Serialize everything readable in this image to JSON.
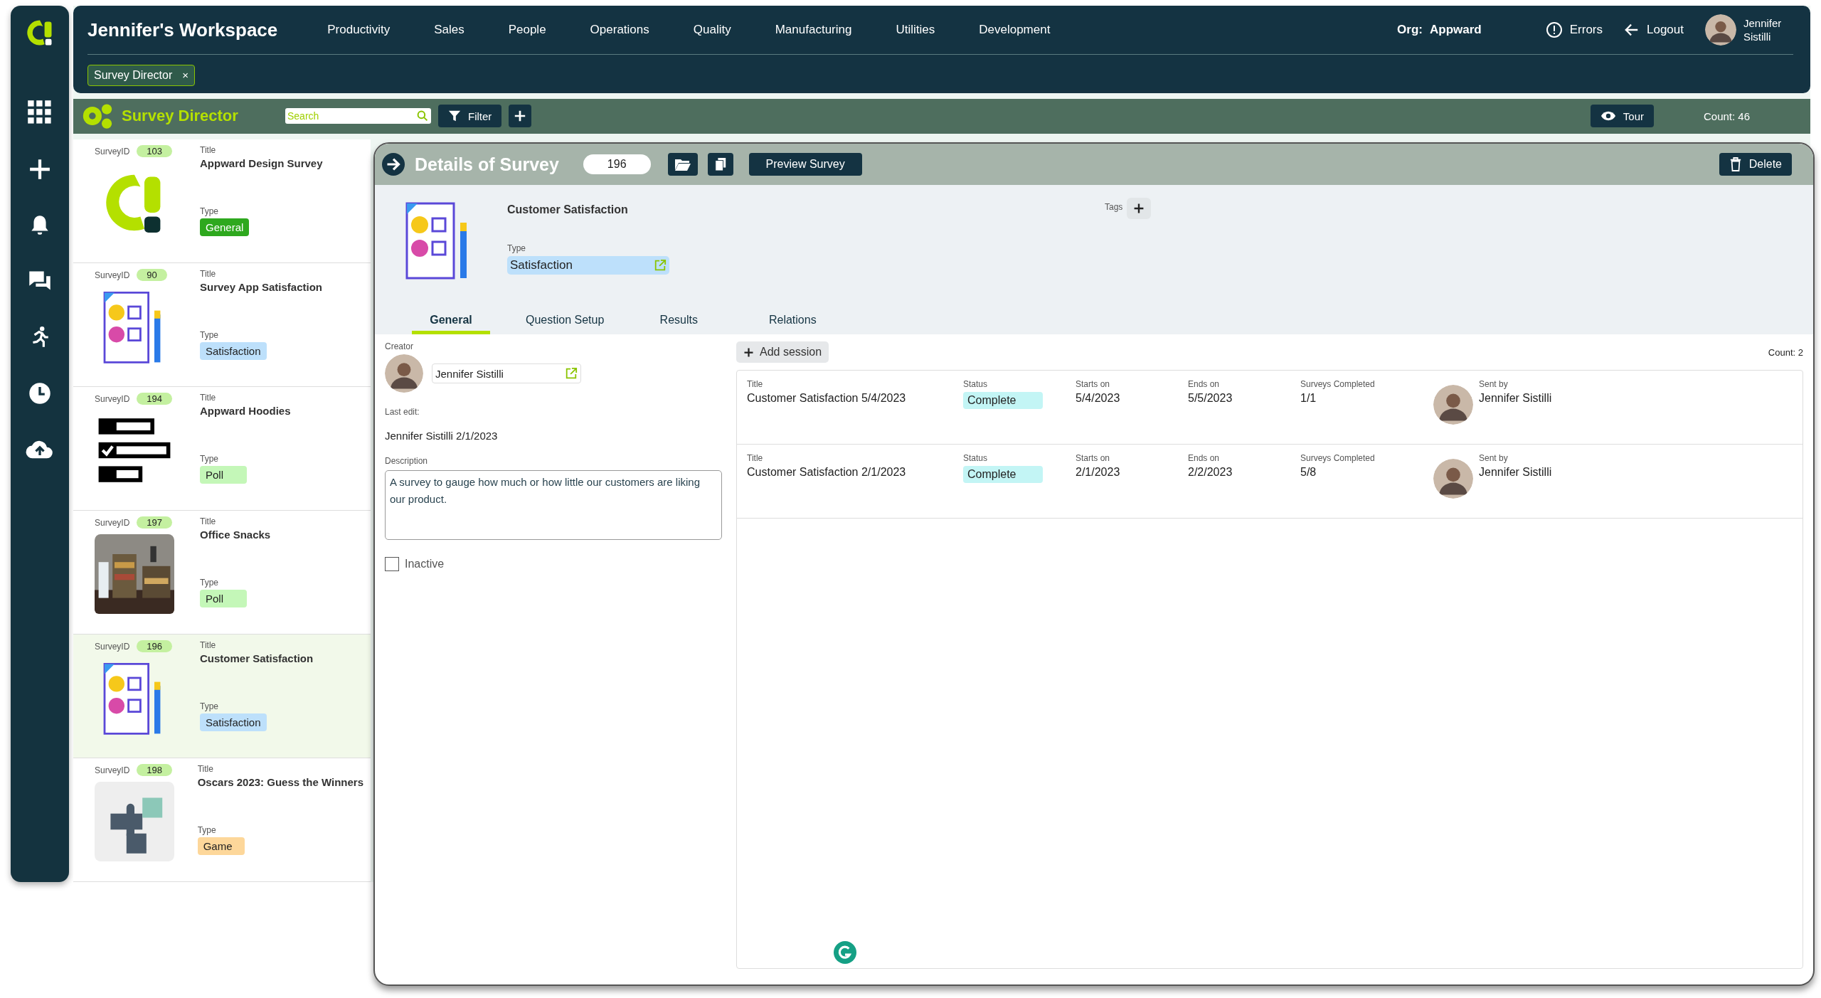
{
  "header": {
    "workspace": "Jennifer's Workspace",
    "nav": [
      "Productivity",
      "Sales",
      "People",
      "Operations",
      "Quality",
      "Manufacturing",
      "Utilities",
      "Development"
    ],
    "org_label": "Org:",
    "org": "Appward",
    "errors": "Errors",
    "logout": "Logout",
    "user": "Jennifer Sistilli",
    "open_tabs": [
      {
        "label": "Survey Director",
        "close": "×"
      }
    ]
  },
  "toolbar": {
    "title": "Survey Director",
    "search": {
      "placeholder": "Search"
    },
    "filter": "Filter",
    "tour": "Tour",
    "count": "Count: 46"
  },
  "surveys": [
    {
      "id_label": "SurveyID",
      "id": "103",
      "title_label": "Title",
      "title": "Appward Design Survey",
      "type_label": "Type",
      "type": "General",
      "color": "#2ea81e",
      "kind": "logo",
      "selected": false
    },
    {
      "id_label": "SurveyID",
      "id": "90",
      "title_label": "Title",
      "title": "Survey App Satisfaction",
      "type_label": "Type",
      "type": "Satisfaction",
      "color": "#bde0fb",
      "kind": "survey",
      "selected": false
    },
    {
      "id_label": "SurveyID",
      "id": "194",
      "title_label": "Title",
      "title": "Appward Hoodies",
      "type_label": "Type",
      "type": "Poll",
      "color": "#c4f7b8",
      "kind": "poll",
      "selected": false
    },
    {
      "id_label": "SurveyID",
      "id": "197",
      "title_label": "Title",
      "title": "Office Snacks",
      "type_label": "Type",
      "type": "Poll",
      "color": "#c4f7b8",
      "kind": "picture",
      "selected": false
    },
    {
      "id_label": "SurveyID",
      "id": "196",
      "title_label": "Title",
      "title": "Customer Satisfaction",
      "type_label": "Type",
      "type": "Satisfaction",
      "color": "#bde0fb",
      "kind": "survey",
      "selected": true
    },
    {
      "id_label": "SurveyID",
      "id": "198",
      "title_label": "Title",
      "title": "Oscars 2023: Guess the Winners",
      "type_label": "Type",
      "type": "Game",
      "color": "#fdd79a",
      "kind": "puzzle",
      "selected": false
    }
  ],
  "detail": {
    "title": "Details of Survey",
    "id": "196",
    "preview": "Preview Survey",
    "delete": "Delete",
    "name": "Customer Satisfaction",
    "type_label": "Type",
    "type": "Satisfaction",
    "tags_label": "Tags",
    "tabs": [
      {
        "label": "General",
        "selected": true
      },
      {
        "label": "Question Setup",
        "selected": false
      },
      {
        "label": "Results",
        "selected": false
      },
      {
        "label": "Relations",
        "selected": false
      }
    ],
    "creator_label": "Creator",
    "creator": "Jennifer Sistilli",
    "last_edit_label": "Last edit:",
    "last_edit": "Jennifer Sistilli 2/1/2023",
    "description_label": "Description",
    "description": "A survey to gauge how much or how little our customers are liking our product.",
    "inactive": {
      "label": "Inactive",
      "checked": false
    },
    "add_session": "Add session",
    "count": "Count: 2",
    "sessions": [
      {
        "fields": [
          {
            "kind": "text",
            "label": "Title",
            "value": "Customer Satisfaction 5/4/2023"
          },
          {
            "kind": "status",
            "label": "Status",
            "value": "Complete"
          },
          {
            "kind": "text",
            "label": "Starts on",
            "value": "5/4/2023"
          },
          {
            "kind": "text",
            "label": "Ends on",
            "value": "5/5/2023"
          },
          {
            "kind": "text",
            "label": "Surveys Completed",
            "value": "1/1"
          },
          {
            "kind": "person",
            "label": "Sent by",
            "value": "Jennifer Sistilli"
          }
        ]
      },
      {
        "fields": [
          {
            "kind": "text",
            "label": "Title",
            "value": "Customer Satisfaction 2/1/2023"
          },
          {
            "kind": "status",
            "label": "Status",
            "value": "Complete"
          },
          {
            "kind": "text",
            "label": "Starts on",
            "value": "2/1/2023"
          },
          {
            "kind": "text",
            "label": "Ends on",
            "value": "2/2/2023"
          },
          {
            "kind": "text",
            "label": "Surveys Completed",
            "value": "5/8"
          },
          {
            "kind": "person",
            "label": "Sent by",
            "value": "Jennifer Sistilli"
          }
        ]
      }
    ]
  }
}
